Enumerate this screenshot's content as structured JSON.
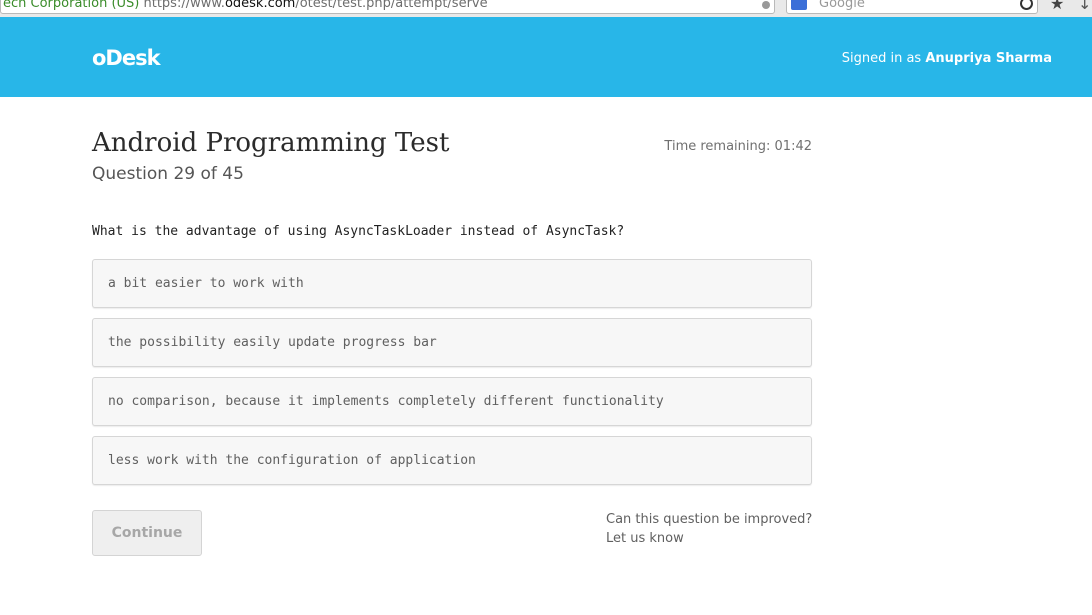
{
  "browser": {
    "url_prefix": "ech Corporation (US)",
    "url_scheme": "https://www.",
    "url_domain": "odesk.com",
    "url_path": "/otest/test.php/attempt/serve",
    "search_placeholder": "Google"
  },
  "header": {
    "logo": "oDesk",
    "signed_in_prefix": "Signed in as",
    "user_name": "Anupriya Sharma",
    "background_color": "#28b6e8"
  },
  "test": {
    "title": "Android Programming Test",
    "question_counter": "Question 29 of 45",
    "time_remaining": "Time remaining: 01:42",
    "question": "What is the advantage of using AsyncTaskLoader instead of AsyncTask?",
    "answers": [
      "a bit easier to work with",
      "the possibility easily update progress bar",
      "no comparison, because it implements completely different functionality",
      "less work with the configuration of application"
    ]
  },
  "actions": {
    "continue_label": "Continue"
  },
  "feedback": {
    "question": "Can this question be improved?",
    "link": "Let us know"
  }
}
